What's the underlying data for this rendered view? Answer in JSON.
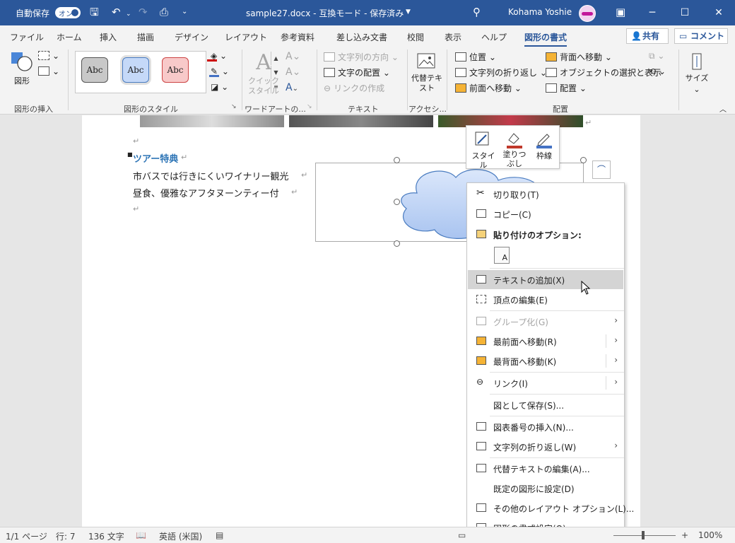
{
  "titlebar": {
    "autosave_label": "自動保存",
    "autosave_state": "オン",
    "document_title": "sample27.docx - 互換モード - 保存済み",
    "user_name": "Kohama Yoshie"
  },
  "tabs": [
    "ファイル",
    "ホーム",
    "挿入",
    "描画",
    "デザイン",
    "レイアウト",
    "参考資料",
    "差し込み文書",
    "校閲",
    "表示",
    "ヘルプ",
    "図形の書式"
  ],
  "active_tab": "図形の書式",
  "share_label": "共有",
  "comment_label": "コメント",
  "ribbon": {
    "insert_group": {
      "shape_label": "図形",
      "group_label": "図形の挿入"
    },
    "style_group": {
      "sample_text": "Abc",
      "group_label": "図形のスタイル"
    },
    "wordart_group": {
      "quick_style_label": "クイック\nスタイル",
      "group_label": "ワードアートの..."
    },
    "text_group": {
      "direction": "文字列の方向",
      "align": "文字の配置",
      "link": "リンクの作成",
      "group_label": "テキスト"
    },
    "access_group": {
      "alt_text": "代替テキ\nスト",
      "group_label": "アクセシ..."
    },
    "arrange_group": {
      "position": "位置",
      "wrap": "文字列の折り返し",
      "forward": "前面へ移動",
      "backward": "背面へ移動",
      "selection_pane": "オブジェクトの選択と表示",
      "align": "配置",
      "group_label": "配置"
    },
    "size_group": {
      "label": "サイズ"
    }
  },
  "document": {
    "bullet_heading": "ツアー特典",
    "line1": "市バスでは行きにくいワイナリー観光",
    "line2": "昼食、優雅なアフタヌーンティー付",
    "return_mark": "↵"
  },
  "mini_toolbar": {
    "style": "スタイル",
    "fill": "塗りつ\nぶし",
    "outline": "枠線"
  },
  "context_menu": {
    "items": [
      {
        "label": "切り取り(T)",
        "icon": "scissors-icon"
      },
      {
        "label": "コピー(C)",
        "icon": "copy-icon"
      },
      {
        "label": "貼り付けのオプション:",
        "icon": "paste-icon"
      },
      {
        "label": "テキストの追加(X)",
        "icon": "textbox-icon"
      },
      {
        "label": "頂点の編集(E)",
        "icon": "edit-points-icon"
      },
      {
        "label": "グループ化(G)",
        "icon": "group-icon"
      },
      {
        "label": "最前面へ移動(R)",
        "icon": "bring-front-icon"
      },
      {
        "label": "最背面へ移動(K)",
        "icon": "send-back-icon"
      },
      {
        "label": "リンク(I)",
        "icon": "link-icon"
      },
      {
        "label": "図として保存(S)...",
        "icon": ""
      },
      {
        "label": "図表番号の挿入(N)...",
        "icon": "caption-icon"
      },
      {
        "label": "文字列の折り返し(W)",
        "icon": "wrap-icon"
      },
      {
        "label": "代替テキストの編集(A)...",
        "icon": "alt-text-icon"
      },
      {
        "label": "既定の図形に設定(D)",
        "icon": ""
      },
      {
        "label": "その他のレイアウト オプション(L)...",
        "icon": "layout-options-icon"
      },
      {
        "label": "図形の書式設定(O)...",
        "icon": "format-shape-icon"
      }
    ]
  },
  "status": {
    "page": "1/1 ページ",
    "line": "行: 7",
    "words": "136 文字",
    "language": "英語 (米国)",
    "zoom": "100%"
  },
  "colors": {
    "accent": "#2b579a",
    "heading_blue": "#2e75b6",
    "cloud_fill": "#c5d9f8",
    "menu_highlight": "#d4d4d4"
  }
}
